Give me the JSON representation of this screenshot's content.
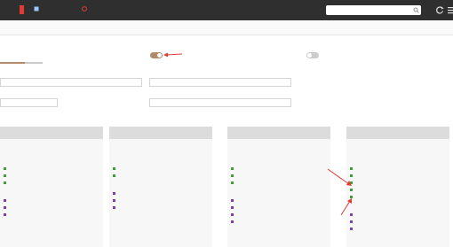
{
  "topbar": {
    "logo_text": "",
    "nav": [
      {
        "label": "",
        "icon": "bookmark-icon"
      },
      {
        "label": "",
        "icon": "target-icon"
      }
    ],
    "search_placeholder": "",
    "colors": {
      "bar": "#2f2f2f",
      "logo_accent": "#e53935"
    }
  },
  "subnav": {
    "tabs": [
      "",
      "",
      "",
      ""
    ]
  },
  "settings": {
    "slider_1": {
      "label": "",
      "value_fraction": 0.58
    },
    "toggle_1": {
      "label": "",
      "on": true,
      "side_label": ""
    },
    "toggle_2": {
      "label": "",
      "on": false
    },
    "field_1": {
      "label": "",
      "value": ""
    },
    "field_2": {
      "label": "",
      "value": ""
    },
    "field_3": {
      "label": "",
      "value": ""
    },
    "field_4": {
      "label": "",
      "value": ""
    }
  },
  "section_heading": "",
  "colors": {
    "green": "#3aa13a",
    "purple": "#7b3fa8",
    "red_arrow": "#e53935",
    "toggle_on": "#b08a6a",
    "toggle_off": "#cccccc"
  },
  "columns": [
    {
      "title": "",
      "rows": [
        {
          "text": "",
          "color": "green"
        }
      ],
      "sections": [
        {
          "head": "",
          "rows": [
            "",
            "",
            ""
          ]
        },
        {
          "head": "",
          "rows": [
            "",
            "",
            ""
          ]
        }
      ]
    },
    {
      "title": "",
      "rows": [
        {
          "text": "",
          "color": "green"
        }
      ],
      "sections": [
        {
          "head": "",
          "rows": [
            "",
            ""
          ]
        },
        {
          "head": "",
          "rows": [
            "",
            "",
            ""
          ]
        }
      ]
    },
    {
      "title": "",
      "rows": [
        {
          "text": "",
          "color": "green"
        }
      ],
      "sections": [
        {
          "head": "",
          "rows": [
            "",
            "",
            ""
          ]
        },
        {
          "head": "",
          "rows": [
            "",
            "",
            "",
            ""
          ]
        }
      ]
    },
    {
      "title": "",
      "rows": [
        {
          "text": "",
          "color": "green"
        }
      ],
      "sections": [
        {
          "head": "",
          "rows": [
            "",
            "",
            "",
            "",
            ""
          ]
        },
        {
          "head": "",
          "rows": [
            "",
            "",
            ""
          ]
        }
      ]
    }
  ]
}
